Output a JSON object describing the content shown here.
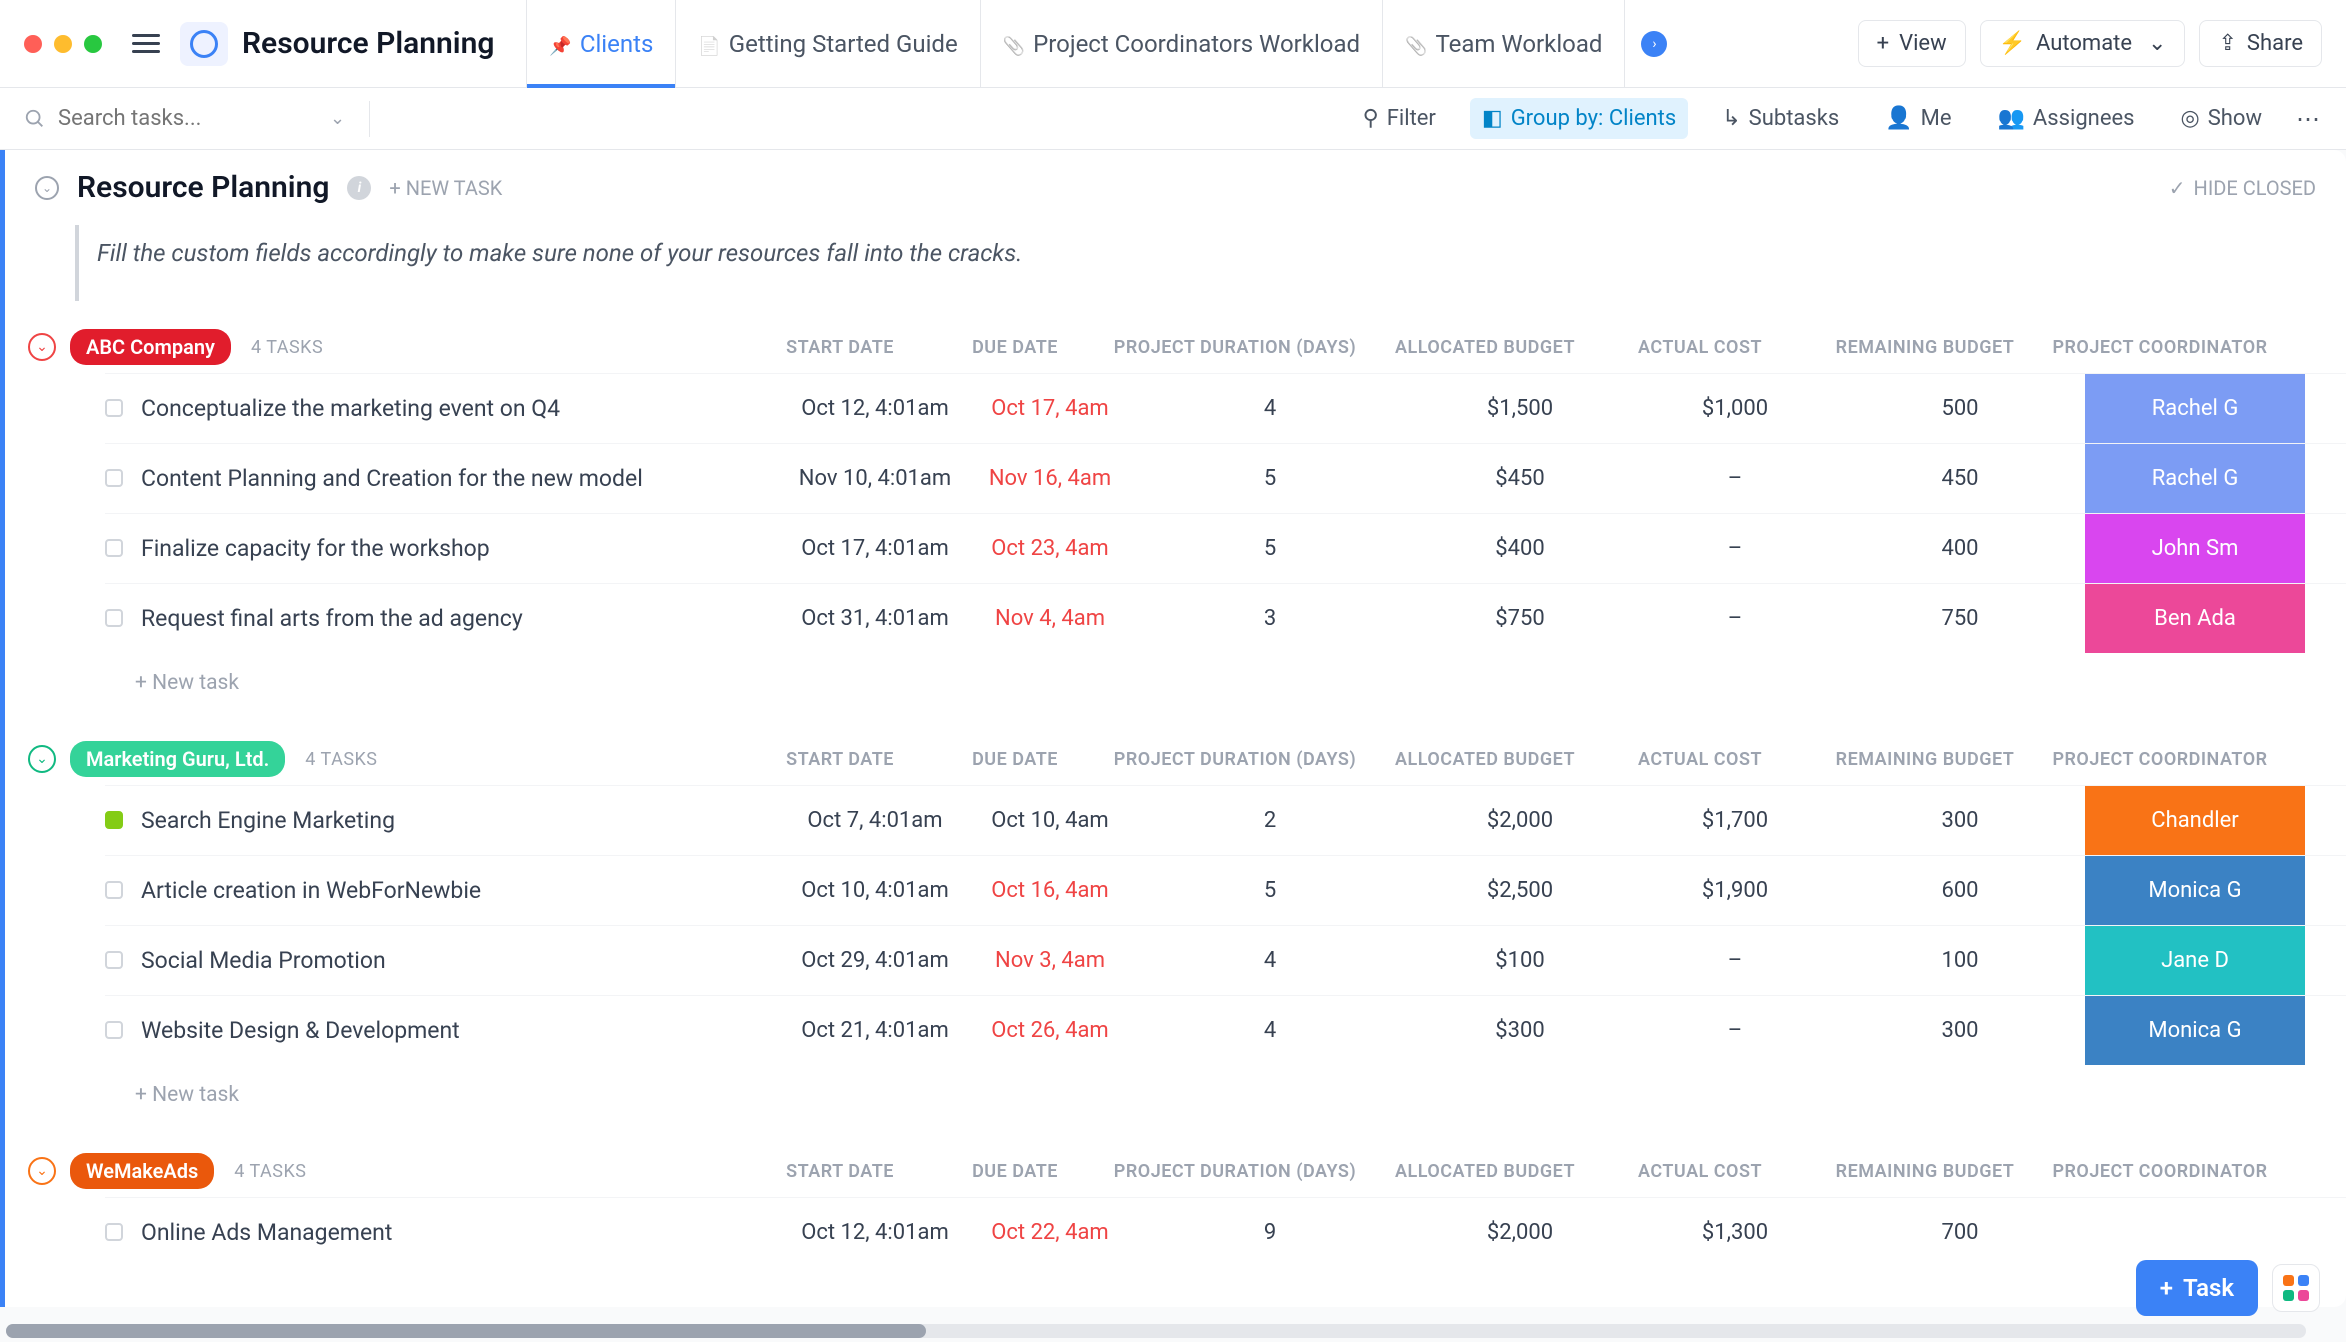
{
  "header": {
    "title": "Resource Planning",
    "tabs": [
      {
        "label": "Clients",
        "active": true
      },
      {
        "label": "Getting Started Guide",
        "active": false
      },
      {
        "label": "Project Coordinators Workload",
        "active": false
      },
      {
        "label": "Team Workload",
        "active": false
      }
    ],
    "view_btn": "View",
    "automate_btn": "Automate",
    "share_btn": "Share"
  },
  "toolbar": {
    "search_placeholder": "Search tasks...",
    "filter": "Filter",
    "group_by": "Group by: Clients",
    "subtasks": "Subtasks",
    "me": "Me",
    "assignees": "Assignees",
    "show": "Show"
  },
  "list": {
    "title": "Resource Planning",
    "new_task": "+ NEW TASK",
    "hide_closed": "HIDE CLOSED",
    "description": "Fill the custom fields accordingly to make sure none of your resources fall into the cracks.",
    "new_task_row": "+ New task"
  },
  "columns": [
    "START DATE",
    "DUE DATE",
    "PROJECT DURATION (DAYS)",
    "ALLOCATED BUDGET",
    "ACTUAL COST",
    "REMAINING BUDGET",
    "PROJECT COORDINATOR"
  ],
  "colors": {
    "abc": "#e11d2c",
    "abc_collapse": "#ef4444",
    "mkguru": "#34d399",
    "mkguru_collapse": "#10b981",
    "wemake": "#ea580c",
    "wemake_collapse": "#f97316",
    "coord_blue": "#7c9cf4",
    "coord_magenta": "#d946ef",
    "coord_pink": "#ec4899",
    "coord_orange": "#f97316",
    "coord_teal": "#22c1c3",
    "coord_steel": "#3b82c4"
  },
  "groups": [
    {
      "id": "abc",
      "name": "ABC Company",
      "task_count": "4 TASKS",
      "badge_color": "abc",
      "collapse_color": "abc_collapse",
      "tasks": [
        {
          "name": "Conceptualize the marketing event on Q4",
          "start": "Oct 12, 4:01am",
          "due": "Oct 17, 4am",
          "due_past": true,
          "dur": "4",
          "alloc": "$1,500",
          "actual": "$1,000",
          "remain": "500",
          "coord": "Rachel G",
          "coord_color": "coord_blue",
          "done": false
        },
        {
          "name": "Content Planning and Creation for the new model",
          "start": "Nov 10, 4:01am",
          "due": "Nov 16, 4am",
          "due_past": true,
          "dur": "5",
          "alloc": "$450",
          "actual": "–",
          "remain": "450",
          "coord": "Rachel G",
          "coord_color": "coord_blue",
          "done": false
        },
        {
          "name": "Finalize capacity for the workshop",
          "start": "Oct 17, 4:01am",
          "due": "Oct 23, 4am",
          "due_past": true,
          "dur": "5",
          "alloc": "$400",
          "actual": "–",
          "remain": "400",
          "coord": "John Sm",
          "coord_color": "coord_magenta",
          "done": false
        },
        {
          "name": "Request final arts from the ad agency",
          "start": "Oct 31, 4:01am",
          "due": "Nov 4, 4am",
          "due_past": true,
          "dur": "3",
          "alloc": "$750",
          "actual": "–",
          "remain": "750",
          "coord": "Ben Ada",
          "coord_color": "coord_pink",
          "done": false
        }
      ]
    },
    {
      "id": "mkguru",
      "name": "Marketing Guru, Ltd.",
      "task_count": "4 TASKS",
      "badge_color": "mkguru",
      "collapse_color": "mkguru_collapse",
      "tasks": [
        {
          "name": "Search Engine Marketing",
          "start": "Oct 7, 4:01am",
          "due": "Oct 10, 4am",
          "due_past": false,
          "dur": "2",
          "alloc": "$2,000",
          "actual": "$1,700",
          "remain": "300",
          "coord": "Chandler",
          "coord_color": "coord_orange",
          "done": true
        },
        {
          "name": "Article creation in WebForNewbie",
          "start": "Oct 10, 4:01am",
          "due": "Oct 16, 4am",
          "due_past": true,
          "dur": "5",
          "alloc": "$2,500",
          "actual": "$1,900",
          "remain": "600",
          "coord": "Monica G",
          "coord_color": "coord_steel",
          "done": false
        },
        {
          "name": "Social Media Promotion",
          "start": "Oct 29, 4:01am",
          "due": "Nov 3, 4am",
          "due_past": true,
          "dur": "4",
          "alloc": "$100",
          "actual": "–",
          "remain": "100",
          "coord": "Jane D",
          "coord_color": "coord_teal",
          "done": false
        },
        {
          "name": "Website Design & Development",
          "start": "Oct 21, 4:01am",
          "due": "Oct 26, 4am",
          "due_past": true,
          "dur": "4",
          "alloc": "$300",
          "actual": "–",
          "remain": "300",
          "coord": "Monica G",
          "coord_color": "coord_steel",
          "done": false
        }
      ]
    },
    {
      "id": "wemake",
      "name": "WeMakeAds",
      "task_count": "4 TASKS",
      "badge_color": "wemake",
      "collapse_color": "wemake_collapse",
      "tasks": [
        {
          "name": "Online Ads Management",
          "start": "Oct 12, 4:01am",
          "due": "Oct 22, 4am",
          "due_past": true,
          "dur": "9",
          "alloc": "$2,000",
          "actual": "$1,300",
          "remain": "700",
          "coord": "",
          "coord_color": "",
          "done": false
        }
      ]
    }
  ],
  "fab": {
    "task": "Task"
  }
}
